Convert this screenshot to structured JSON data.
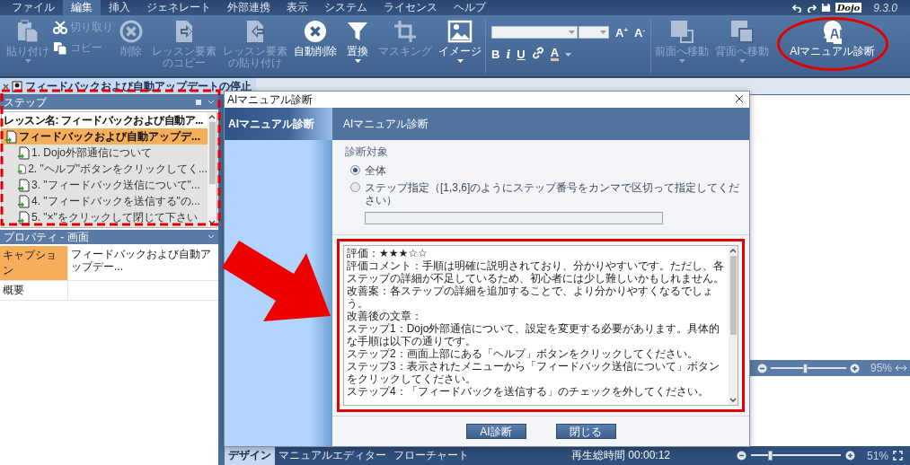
{
  "menu": [
    {
      "label": "ファイル",
      "selected": false
    },
    {
      "label": "編集",
      "selected": true
    },
    {
      "label": "挿入",
      "selected": false
    },
    {
      "label": "ジェネレート",
      "selected": false
    },
    {
      "label": "外部連携",
      "selected": false
    },
    {
      "label": "表示",
      "selected": false
    },
    {
      "label": "システム",
      "selected": false
    },
    {
      "label": "ライセンス",
      "selected": false
    },
    {
      "label": "ヘルプ",
      "selected": false
    }
  ],
  "title_area": {
    "logo": "Dojo",
    "version": "9.3.0"
  },
  "ribbon": [
    {
      "kind": "large",
      "lines": [
        "貼り付け"
      ],
      "disabled": true,
      "dropdown": true
    },
    {
      "kind": "stack",
      "items": [
        {
          "label": "切り取り",
          "disabled": true
        },
        {
          "label": "コピー",
          "disabled": true
        }
      ]
    },
    {
      "kind": "large",
      "lines": [
        "削除"
      ],
      "disabled": true,
      "dropdown": false
    },
    {
      "kind": "large",
      "lines": [
        "レッスン要素",
        "のコピー"
      ],
      "disabled": true,
      "dropdown": false
    },
    {
      "kind": "large",
      "lines": [
        "レッスン要素",
        "の貼り付け"
      ],
      "disabled": true,
      "dropdown": false
    },
    {
      "kind": "large",
      "lines": [
        "自動削除"
      ],
      "disabled": false,
      "dropdown": false
    },
    {
      "kind": "large",
      "lines": [
        "置換"
      ],
      "disabled": false,
      "dropdown": true
    },
    {
      "kind": "large",
      "lines": [
        "マスキング"
      ],
      "disabled": true,
      "dropdown": false
    },
    {
      "kind": "large",
      "lines": [
        "イメージ"
      ],
      "disabled": false,
      "dropdown": true
    },
    {
      "kind": "font",
      "size_up": "A$^{+}$",
      "size_down": "A$^{-}$",
      "format": [
        "B",
        "i",
        "U"
      ],
      "text_color_button": "A"
    },
    {
      "kind": "large",
      "lines": [
        "前面へ移動"
      ],
      "disabled": true,
      "dropdown": true
    },
    {
      "kind": "large",
      "lines": [
        "背面へ移動"
      ],
      "disabled": true,
      "dropdown": true
    },
    {
      "kind": "large",
      "lines": [
        "AIマニュアル診断"
      ],
      "disabled": false,
      "dropdown": false
    }
  ],
  "document_tab": {
    "title": "フィードバックおよび自動アップデートの停止"
  },
  "steps_panel": {
    "title": "ステップ",
    "lesson": "レッスン名: フィードバックおよび自動ア...",
    "tree": [
      {
        "label": "フィードバックおよび自動アップデ...",
        "selected": true,
        "children": [
          {
            "label": "1. Dojo外部通信について",
            "selected": false
          },
          {
            "label": "2. \"ヘルプ\"ボタンをクリックしてく...",
            "selected": false
          },
          {
            "label": "3. \"フィードバック送信について\"...",
            "selected": false
          },
          {
            "label": "4. \"フィードバックを送信する\"の...",
            "selected": false
          },
          {
            "label": "5. \"×\"をクリックして閉じて下さい",
            "selected": false
          }
        ]
      }
    ]
  },
  "properties_panel": {
    "title": "プロパティ - 画面",
    "rows": [
      {
        "name": "キャプション",
        "value": "フィードバックおよび自動アップデー...",
        "selected": true
      },
      {
        "name": "概要",
        "selected": false
      }
    ]
  },
  "timeline": {
    "zoom": {
      "level": 0.46,
      "reading": "95%"
    }
  },
  "status_bar": {
    "tabs": [
      {
        "label": "デザイン",
        "selected": true
      },
      {
        "label": "マニュアルエディター",
        "selected": false
      },
      {
        "label": "フローチャート",
        "selected": false
      }
    ],
    "total_time": "再生総時間 00:00:12",
    "zoom": {
      "level": 0.22,
      "reading": "51%"
    }
  },
  "dialog": {
    "title": "AIマニュアル診断",
    "nav": [
      {
        "label": "AIマニュアル診断",
        "selected": true
      }
    ],
    "header": "AIマニュアル診断",
    "section": "診断対象",
    "options": [
      {
        "label": "全体",
        "selected": true
      },
      {
        "label": "ステップ指定（[1,3,6]のようにステップ番号をカンマで区切って指定してください）",
        "selected": false
      }
    ],
    "result_lines": [
      "評価：★★★☆☆",
      "評価コメント：手順は明確に説明されており、分かりやすいです。ただし、各ステップの詳細が不足しているため、初心者には少し難しいかもしれません。",
      "改善案：各ステップの詳細を追加することで、より分かりやすくなるでしょう。",
      "改善後の文章：",
      "ステップ1：Dojo外部通信について、設定を変更する必要があります。具体的な手順は以下の通りです。",
      "ステップ2：画面上部にある「ヘルプ」ボタンをクリックしてください。",
      "ステップ3：表示されたメニューから「フィードバック送信について」ボタンをクリックしてください。",
      "ステップ4：「フィードバックを送信する」のチェックを外してください。"
    ],
    "buttons": [
      "AI診断",
      "閉じる"
    ]
  }
}
